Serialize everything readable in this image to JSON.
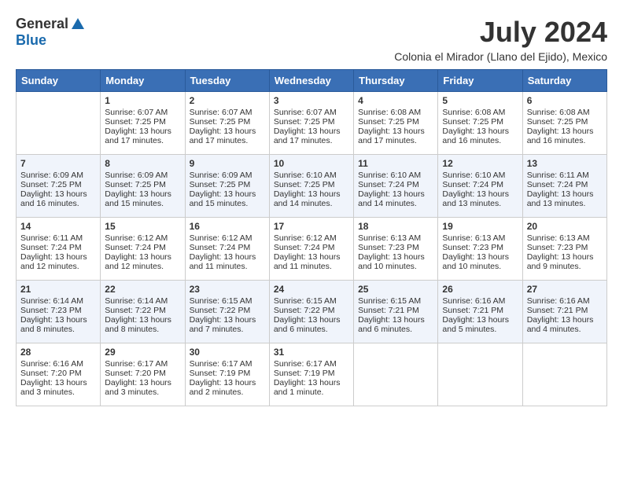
{
  "logo": {
    "general": "General",
    "blue": "Blue"
  },
  "title": {
    "month_year": "July 2024",
    "location": "Colonia el Mirador (Llano del Ejido), Mexico"
  },
  "days_of_week": [
    "Sunday",
    "Monday",
    "Tuesday",
    "Wednesday",
    "Thursday",
    "Friday",
    "Saturday"
  ],
  "weeks": [
    [
      {
        "day": "",
        "sunrise": "",
        "sunset": "",
        "daylight": ""
      },
      {
        "day": "1",
        "sunrise": "Sunrise: 6:07 AM",
        "sunset": "Sunset: 7:25 PM",
        "daylight": "Daylight: 13 hours and 17 minutes."
      },
      {
        "day": "2",
        "sunrise": "Sunrise: 6:07 AM",
        "sunset": "Sunset: 7:25 PM",
        "daylight": "Daylight: 13 hours and 17 minutes."
      },
      {
        "day": "3",
        "sunrise": "Sunrise: 6:07 AM",
        "sunset": "Sunset: 7:25 PM",
        "daylight": "Daylight: 13 hours and 17 minutes."
      },
      {
        "day": "4",
        "sunrise": "Sunrise: 6:08 AM",
        "sunset": "Sunset: 7:25 PM",
        "daylight": "Daylight: 13 hours and 17 minutes."
      },
      {
        "day": "5",
        "sunrise": "Sunrise: 6:08 AM",
        "sunset": "Sunset: 7:25 PM",
        "daylight": "Daylight: 13 hours and 16 minutes."
      },
      {
        "day": "6",
        "sunrise": "Sunrise: 6:08 AM",
        "sunset": "Sunset: 7:25 PM",
        "daylight": "Daylight: 13 hours and 16 minutes."
      }
    ],
    [
      {
        "day": "7",
        "sunrise": "Sunrise: 6:09 AM",
        "sunset": "Sunset: 7:25 PM",
        "daylight": "Daylight: 13 hours and 16 minutes."
      },
      {
        "day": "8",
        "sunrise": "Sunrise: 6:09 AM",
        "sunset": "Sunset: 7:25 PM",
        "daylight": "Daylight: 13 hours and 15 minutes."
      },
      {
        "day": "9",
        "sunrise": "Sunrise: 6:09 AM",
        "sunset": "Sunset: 7:25 PM",
        "daylight": "Daylight: 13 hours and 15 minutes."
      },
      {
        "day": "10",
        "sunrise": "Sunrise: 6:10 AM",
        "sunset": "Sunset: 7:25 PM",
        "daylight": "Daylight: 13 hours and 14 minutes."
      },
      {
        "day": "11",
        "sunrise": "Sunrise: 6:10 AM",
        "sunset": "Sunset: 7:24 PM",
        "daylight": "Daylight: 13 hours and 14 minutes."
      },
      {
        "day": "12",
        "sunrise": "Sunrise: 6:10 AM",
        "sunset": "Sunset: 7:24 PM",
        "daylight": "Daylight: 13 hours and 13 minutes."
      },
      {
        "day": "13",
        "sunrise": "Sunrise: 6:11 AM",
        "sunset": "Sunset: 7:24 PM",
        "daylight": "Daylight: 13 hours and 13 minutes."
      }
    ],
    [
      {
        "day": "14",
        "sunrise": "Sunrise: 6:11 AM",
        "sunset": "Sunset: 7:24 PM",
        "daylight": "Daylight: 13 hours and 12 minutes."
      },
      {
        "day": "15",
        "sunrise": "Sunrise: 6:12 AM",
        "sunset": "Sunset: 7:24 PM",
        "daylight": "Daylight: 13 hours and 12 minutes."
      },
      {
        "day": "16",
        "sunrise": "Sunrise: 6:12 AM",
        "sunset": "Sunset: 7:24 PM",
        "daylight": "Daylight: 13 hours and 11 minutes."
      },
      {
        "day": "17",
        "sunrise": "Sunrise: 6:12 AM",
        "sunset": "Sunset: 7:24 PM",
        "daylight": "Daylight: 13 hours and 11 minutes."
      },
      {
        "day": "18",
        "sunrise": "Sunrise: 6:13 AM",
        "sunset": "Sunset: 7:23 PM",
        "daylight": "Daylight: 13 hours and 10 minutes."
      },
      {
        "day": "19",
        "sunrise": "Sunrise: 6:13 AM",
        "sunset": "Sunset: 7:23 PM",
        "daylight": "Daylight: 13 hours and 10 minutes."
      },
      {
        "day": "20",
        "sunrise": "Sunrise: 6:13 AM",
        "sunset": "Sunset: 7:23 PM",
        "daylight": "Daylight: 13 hours and 9 minutes."
      }
    ],
    [
      {
        "day": "21",
        "sunrise": "Sunrise: 6:14 AM",
        "sunset": "Sunset: 7:23 PM",
        "daylight": "Daylight: 13 hours and 8 minutes."
      },
      {
        "day": "22",
        "sunrise": "Sunrise: 6:14 AM",
        "sunset": "Sunset: 7:22 PM",
        "daylight": "Daylight: 13 hours and 8 minutes."
      },
      {
        "day": "23",
        "sunrise": "Sunrise: 6:15 AM",
        "sunset": "Sunset: 7:22 PM",
        "daylight": "Daylight: 13 hours and 7 minutes."
      },
      {
        "day": "24",
        "sunrise": "Sunrise: 6:15 AM",
        "sunset": "Sunset: 7:22 PM",
        "daylight": "Daylight: 13 hours and 6 minutes."
      },
      {
        "day": "25",
        "sunrise": "Sunrise: 6:15 AM",
        "sunset": "Sunset: 7:21 PM",
        "daylight": "Daylight: 13 hours and 6 minutes."
      },
      {
        "day": "26",
        "sunrise": "Sunrise: 6:16 AM",
        "sunset": "Sunset: 7:21 PM",
        "daylight": "Daylight: 13 hours and 5 minutes."
      },
      {
        "day": "27",
        "sunrise": "Sunrise: 6:16 AM",
        "sunset": "Sunset: 7:21 PM",
        "daylight": "Daylight: 13 hours and 4 minutes."
      }
    ],
    [
      {
        "day": "28",
        "sunrise": "Sunrise: 6:16 AM",
        "sunset": "Sunset: 7:20 PM",
        "daylight": "Daylight: 13 hours and 3 minutes."
      },
      {
        "day": "29",
        "sunrise": "Sunrise: 6:17 AM",
        "sunset": "Sunset: 7:20 PM",
        "daylight": "Daylight: 13 hours and 3 minutes."
      },
      {
        "day": "30",
        "sunrise": "Sunrise: 6:17 AM",
        "sunset": "Sunset: 7:19 PM",
        "daylight": "Daylight: 13 hours and 2 minutes."
      },
      {
        "day": "31",
        "sunrise": "Sunrise: 6:17 AM",
        "sunset": "Sunset: 7:19 PM",
        "daylight": "Daylight: 13 hours and 1 minute."
      },
      {
        "day": "",
        "sunrise": "",
        "sunset": "",
        "daylight": ""
      },
      {
        "day": "",
        "sunrise": "",
        "sunset": "",
        "daylight": ""
      },
      {
        "day": "",
        "sunrise": "",
        "sunset": "",
        "daylight": ""
      }
    ]
  ]
}
